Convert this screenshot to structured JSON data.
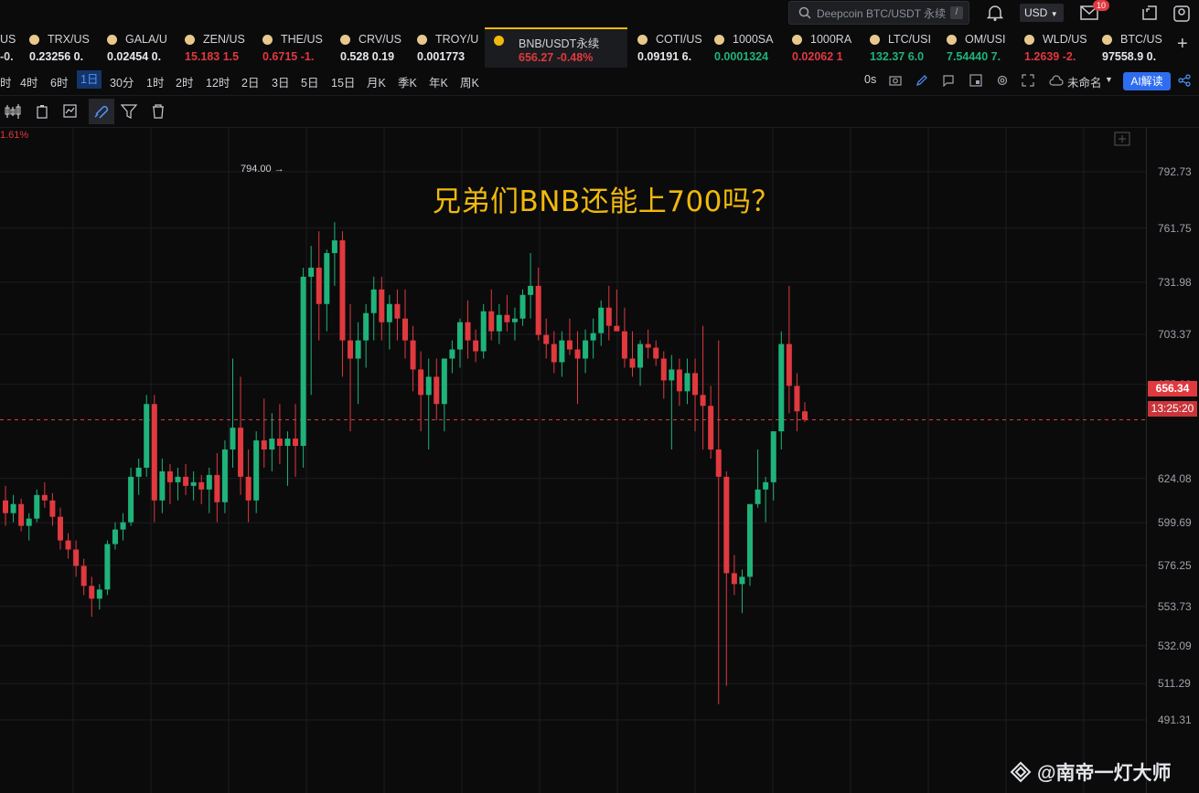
{
  "search": {
    "placeholder": "Deepcoin BTC/USDT 永续",
    "shortcut": "/"
  },
  "currency": "USD",
  "notifications": "10",
  "tickers": [
    {
      "sym": "US",
      "val": "-0.",
      "color": "#d0d2d6"
    },
    {
      "sym": "TRX/US",
      "val": "0.23256  0.",
      "color": "#e6e8eb"
    },
    {
      "sym": "GALA/U",
      "val": "0.02454  0.",
      "color": "#e6e8eb"
    },
    {
      "sym": "ZEN/US",
      "val": "15.183  1.5",
      "color": "#e0393e"
    },
    {
      "sym": "THE/US",
      "val": "0.6715  -1.",
      "color": "#e0393e"
    },
    {
      "sym": "CRV/US",
      "val": "0.528  0.19",
      "color": "#e6e8eb"
    },
    {
      "sym": "TROY/U",
      "val": "0.001773",
      "color": "#e6e8eb"
    },
    {
      "sym": "BNB/USDT永续",
      "val": "656.27  -0.48%",
      "color": "#e0393e"
    },
    {
      "sym": "COTI/US",
      "val": "0.09191  6.",
      "color": "#e6e8eb"
    },
    {
      "sym": "1000SA",
      "val": "0.0001324",
      "color": "#1fb37a"
    },
    {
      "sym": "1000RA",
      "val": "0.02062  1",
      "color": "#e0393e"
    },
    {
      "sym": "LTC/USI",
      "val": "132.37  6.0",
      "color": "#1fb37a"
    },
    {
      "sym": "OM/USI",
      "val": "7.54440  7.",
      "color": "#1fb37a"
    },
    {
      "sym": "WLD/US",
      "val": "1.2639  -2.",
      "color": "#e0393e"
    },
    {
      "sym": "BTC/US",
      "val": "97558.9  0.",
      "color": "#e6e8eb"
    }
  ],
  "timeframes": [
    "时",
    "4时",
    "6时",
    "1日",
    "30分",
    "1时",
    "2时",
    "12时",
    "2日",
    "3日",
    "5日",
    "15日",
    "月K",
    "季K",
    "年K",
    "周K"
  ],
  "active_timeframe": "1日",
  "toolbar_right": {
    "countdown": "0s",
    "layout_name": "未命名",
    "ai_button": "AI解读"
  },
  "chart": {
    "pct_label": "1.61%",
    "title_text": "兄弟们BNB还能上700吗？",
    "high_label": "794.00",
    "current_price": "656.34",
    "countdown": "13:25:20",
    "y_ticks": [
      "792.73",
      "761.75",
      "731.98",
      "703.37",
      "675.88",
      "656.34",
      "624.08",
      "599.69",
      "576.25",
      "553.73",
      "532.09",
      "511.29",
      "491.31"
    ]
  },
  "chart_data": {
    "type": "candlestick",
    "title": "兄弟们BNB还能上700吗？",
    "ylim": [
      485,
      800
    ],
    "last_price": 656.34,
    "high": 794.0,
    "candles": [
      [
        612,
        620,
        598,
        605
      ],
      [
        605,
        615,
        600,
        610
      ],
      [
        610,
        613,
        595,
        598
      ],
      [
        598,
        605,
        590,
        602
      ],
      [
        602,
        618,
        600,
        615
      ],
      [
        615,
        622,
        608,
        612
      ],
      [
        612,
        616,
        598,
        603
      ],
      [
        603,
        608,
        585,
        590
      ],
      [
        590,
        594,
        580,
        585
      ],
      [
        585,
        590,
        570,
        576
      ],
      [
        576,
        580,
        560,
        565
      ],
      [
        565,
        570,
        548,
        558
      ],
      [
        558,
        566,
        552,
        563
      ],
      [
        563,
        590,
        560,
        588
      ],
      [
        588,
        600,
        585,
        596
      ],
      [
        596,
        605,
        590,
        600
      ],
      [
        600,
        630,
        598,
        625
      ],
      [
        625,
        635,
        615,
        630
      ],
      [
        630,
        670,
        625,
        665
      ],
      [
        665,
        670,
        600,
        612
      ],
      [
        612,
        635,
        605,
        628
      ],
      [
        628,
        632,
        610,
        622
      ],
      [
        622,
        630,
        612,
        625
      ],
      [
        625,
        632,
        615,
        620
      ],
      [
        620,
        628,
        612,
        622
      ],
      [
        622,
        626,
        610,
        618
      ],
      [
        618,
        630,
        605,
        626
      ],
      [
        626,
        638,
        600,
        611
      ],
      [
        611,
        645,
        605,
        640
      ],
      [
        640,
        690,
        630,
        652
      ],
      [
        652,
        680,
        615,
        625
      ],
      [
        625,
        640,
        600,
        612
      ],
      [
        612,
        650,
        605,
        645
      ],
      [
        645,
        668,
        630,
        640
      ],
      [
        640,
        660,
        628,
        646
      ],
      [
        646,
        665,
        632,
        642
      ],
      [
        642,
        650,
        620,
        646
      ],
      [
        646,
        665,
        625,
        642
      ],
      [
        642,
        740,
        630,
        735
      ],
      [
        735,
        752,
        670,
        740
      ],
      [
        740,
        760,
        700,
        720
      ],
      [
        720,
        750,
        705,
        748
      ],
      [
        748,
        765,
        730,
        755
      ],
      [
        755,
        760,
        680,
        700
      ],
      [
        700,
        720,
        650,
        690
      ],
      [
        690,
        710,
        665,
        700
      ],
      [
        700,
        720,
        685,
        715
      ],
      [
        715,
        735,
        700,
        728
      ],
      [
        728,
        735,
        700,
        710
      ],
      [
        710,
        725,
        695,
        720
      ],
      [
        720,
        728,
        700,
        712
      ],
      [
        712,
        728,
        690,
        700
      ],
      [
        700,
        708,
        672,
        684
      ],
      [
        684,
        694,
        650,
        670
      ],
      [
        670,
        690,
        640,
        680
      ],
      [
        680,
        690,
        656,
        665
      ],
      [
        665,
        688,
        650,
        690
      ],
      [
        690,
        700,
        682,
        695
      ],
      [
        695,
        712,
        685,
        710
      ],
      [
        710,
        722,
        690,
        700
      ],
      [
        700,
        706,
        688,
        694
      ],
      [
        694,
        720,
        690,
        716
      ],
      [
        716,
        728,
        700,
        705
      ],
      [
        705,
        720,
        698,
        714
      ],
      [
        714,
        725,
        705,
        710
      ],
      [
        710,
        718,
        700,
        712
      ],
      [
        712,
        728,
        708,
        725
      ],
      [
        725,
        748,
        712,
        730
      ],
      [
        730,
        740,
        700,
        703
      ],
      [
        703,
        712,
        690,
        698
      ],
      [
        698,
        705,
        682,
        688
      ],
      [
        688,
        705,
        680,
        700
      ],
      [
        700,
        712,
        692,
        695
      ],
      [
        695,
        705,
        665,
        690
      ],
      [
        690,
        706,
        682,
        700
      ],
      [
        700,
        712,
        690,
        704
      ],
      [
        704,
        722,
        697,
        718
      ],
      [
        718,
        730,
        700,
        708
      ],
      [
        708,
        728,
        706,
        705
      ],
      [
        705,
        718,
        685,
        690
      ],
      [
        690,
        705,
        680,
        685
      ],
      [
        685,
        700,
        675,
        698
      ],
      [
        698,
        706,
        690,
        696
      ],
      [
        696,
        700,
        686,
        690
      ],
      [
        690,
        694,
        668,
        678
      ],
      [
        678,
        692,
        640,
        684
      ],
      [
        684,
        690,
        664,
        672
      ],
      [
        672,
        690,
        665,
        682
      ],
      [
        682,
        690,
        650,
        670
      ],
      [
        670,
        708,
        640,
        664
      ],
      [
        664,
        675,
        635,
        640
      ],
      [
        640,
        700,
        500,
        625
      ],
      [
        625,
        628,
        510,
        572
      ],
      [
        572,
        582,
        560,
        566
      ],
      [
        566,
        574,
        550,
        570
      ],
      [
        570,
        592,
        565,
        610
      ],
      [
        610,
        640,
        608,
        618
      ],
      [
        618,
        625,
        600,
        622
      ],
      [
        622,
        650,
        612,
        650
      ],
      [
        650,
        705,
        640,
        698
      ],
      [
        698,
        730,
        660,
        675
      ],
      [
        675,
        682,
        650,
        661
      ],
      [
        661,
        666,
        655,
        656.34
      ]
    ]
  }
}
